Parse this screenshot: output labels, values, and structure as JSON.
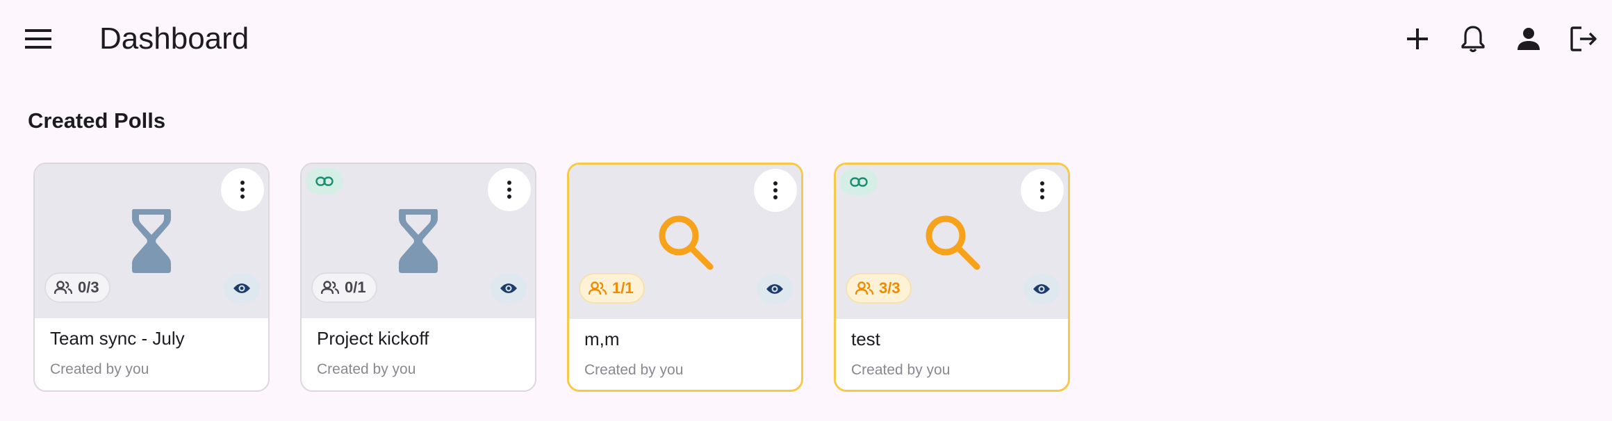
{
  "header": {
    "title": "Dashboard",
    "icons": [
      "menu-icon",
      "add-icon",
      "bell-icon",
      "person-icon",
      "logout-icon"
    ]
  },
  "section": {
    "title": "Created Polls"
  },
  "colors": {
    "background": "#fdf7fd",
    "accent_amber": "#f7a21b",
    "accent_border": "#f7c948",
    "hourglass": "#7d98b3",
    "eye": "#1c3d6b",
    "link": "#1a8d6e"
  },
  "polls": [
    {
      "title": "Team sync - July",
      "subtitle": "Created by you",
      "participants": "0/3",
      "status_icon": "hourglass-icon",
      "has_link": false,
      "highlighted": false
    },
    {
      "title": "Project kickoff",
      "subtitle": "Created by you",
      "participants": "0/1",
      "status_icon": "hourglass-icon",
      "has_link": true,
      "highlighted": false
    },
    {
      "title": "m,m",
      "subtitle": "Created by you",
      "participants": "1/1",
      "status_icon": "search-icon",
      "has_link": false,
      "highlighted": true
    },
    {
      "title": "test",
      "subtitle": "Created by you",
      "participants": "3/3",
      "status_icon": "search-icon",
      "has_link": true,
      "highlighted": true
    }
  ]
}
